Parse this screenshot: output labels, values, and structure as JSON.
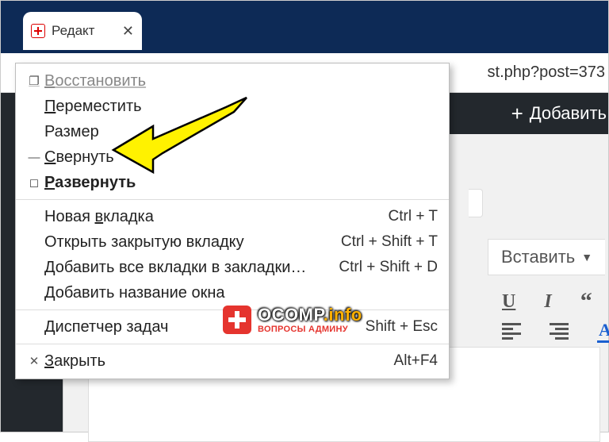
{
  "tab": {
    "title": "Редакт",
    "close_glyph": "✕"
  },
  "address": {
    "fragment": "st.php?post=373"
  },
  "page": {
    "add_label": "Добавить"
  },
  "editor": {
    "insert_label": "Вставить",
    "caret": "▼",
    "btn_u": "U",
    "btn_i": "I",
    "btn_q": "“",
    "btn_a": "A"
  },
  "menu": {
    "restore": {
      "label_pre": "",
      "label_ul": "В",
      "label_post": "осстановить",
      "disabled": true,
      "icon": "❐"
    },
    "move": {
      "label_pre": "",
      "label_ul": "П",
      "label_post": "ереместить"
    },
    "size": {
      "label_pre": "Размер",
      "label_ul": "",
      "label_post": ""
    },
    "minimize": {
      "label_pre": "",
      "label_ul": "С",
      "label_post": "вернуть",
      "icon": "—"
    },
    "maximize": {
      "label_pre": "",
      "label_ul": "Р",
      "label_post": "азвернуть",
      "icon": "◻",
      "bold": true
    },
    "newtab": {
      "label_pre": "Новая ",
      "label_ul": "в",
      "label_post": "кладка",
      "shortcut": "Ctrl + T"
    },
    "reopen": {
      "label_pre": "Открыть закрытую вкладку",
      "label_ul": "",
      "label_post": "",
      "shortcut": "Ctrl + Shift + T"
    },
    "bookmark": {
      "label_pre": "Добавить все вкладки в закладки…",
      "label_ul": "",
      "label_post": "",
      "shortcut": "Ctrl + Shift + D"
    },
    "winname": {
      "label_pre": "Добавить название окна",
      "label_ul": "",
      "label_post": ""
    },
    "taskmgr": {
      "label_pre": "",
      "label_ul": "Д",
      "label_post": "испетчер задач",
      "shortcut": "Shift + Esc"
    },
    "close": {
      "label_pre": "",
      "label_ul": "З",
      "label_post": "акрыть",
      "shortcut": "Alt+F4",
      "icon": "✕"
    }
  },
  "watermark": {
    "brand1": "OCOMP",
    "brand2": ".info",
    "tagline": "ВОПРОСЫ АДМИНУ"
  }
}
